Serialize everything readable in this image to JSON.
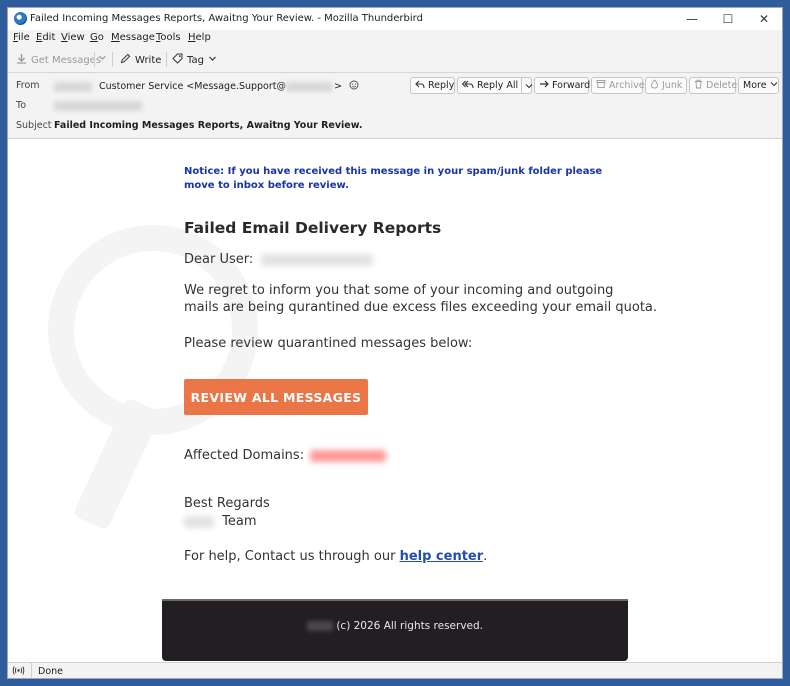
{
  "window": {
    "title": "Failed Incoming Messages Reports, Awaitng Your Review. - Mozilla Thunderbird",
    "controls": {
      "minimize": "—",
      "maximize": "☐",
      "close": "✕"
    }
  },
  "menu": [
    {
      "first": "F",
      "rest": "ile"
    },
    {
      "first": "E",
      "rest": "dit"
    },
    {
      "first": "V",
      "rest": "iew"
    },
    {
      "first": "G",
      "rest": "o"
    },
    {
      "first": "M",
      "rest": "essage"
    },
    {
      "first": "T",
      "rest": "ools"
    },
    {
      "first": "H",
      "rest": "elp"
    }
  ],
  "toolbar": {
    "get_messages": "Get Messages",
    "write": "Write",
    "tag": "Tag"
  },
  "header": {
    "from_label": "From",
    "to_label": "To",
    "subject_label": "Subject",
    "from_name": "Customer Service <Message.Support@",
    "from_end": ">",
    "subject": "Failed Incoming Messages Reports, Awaitng Your Review.",
    "buttons": {
      "reply": "Reply",
      "reply_all": "Reply All",
      "forward": "Forward",
      "archive": "Archive",
      "junk": "Junk",
      "delete": "Delete",
      "more": "More"
    }
  },
  "email": {
    "notice": "Notice: If you have received this message in your spam/junk folder please move to inbox before review.",
    "title": "Failed Email Delivery Reports",
    "greeting": "Dear User:",
    "body_line1": "We regret to inform you that some of your incoming and outgoing",
    "body_line2": "mails are being qurantined due excess files exceeding your email quota.",
    "review_prompt": "Please review quarantined messages below:",
    "review_button": "REVIEW ALL MESSAGES",
    "affected_label": "Affected Domains:",
    "regards": "Best Regards",
    "team": "Team",
    "help_prefix": "For help, Contact us through our ",
    "help_link": "help center",
    "help_suffix": ".",
    "footer": "(c) 2026 All rights reserved."
  },
  "status": {
    "text": "Done"
  }
}
